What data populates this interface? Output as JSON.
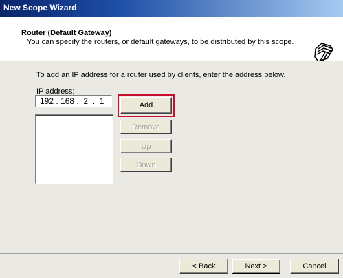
{
  "window": {
    "title": "New Scope Wizard"
  },
  "header": {
    "title": "Router (Default Gateway)",
    "description": "You can specify the routers, or default gateways, to be distributed by this scope.",
    "icon": "folders-icon"
  },
  "main": {
    "instruction": "To add an IP address for a router used by clients, enter the address below.",
    "ip_label": "IP address:",
    "ip_value": "192 . 168 .  2  .  1",
    "routers": [],
    "buttons": {
      "add": "Add",
      "remove": "Remove",
      "up": "Up",
      "down": "Down"
    },
    "highlight_color": "#c8102e"
  },
  "footer": {
    "back": "< Back",
    "next": "Next >",
    "cancel": "Cancel"
  },
  "colors": {
    "title_bar": "#0a246a",
    "body_bg": "#ebe9e3"
  }
}
